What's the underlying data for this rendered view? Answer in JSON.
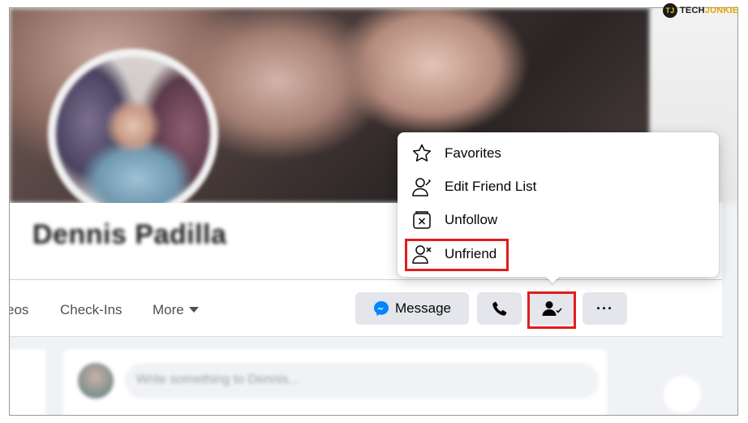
{
  "profile": {
    "name": "Dennis Padilla"
  },
  "nav": {
    "videos_partial": "eos",
    "checkins": "Check-Ins",
    "more": "More"
  },
  "actions": {
    "message_label": "Message",
    "more_label": "···"
  },
  "menu": {
    "items": [
      {
        "label": "Favorites",
        "icon": "star-icon"
      },
      {
        "label": "Edit Friend List",
        "icon": "edit-friend-list-icon"
      },
      {
        "label": "Unfollow",
        "icon": "unfollow-icon"
      },
      {
        "label": "Unfriend",
        "icon": "unfriend-icon"
      }
    ]
  },
  "composer": {
    "placeholder": "Write something to Dennis..."
  },
  "watermark": {
    "badge": "TJ",
    "tech": "TECH",
    "junkie": "JUNKIE"
  },
  "colors": {
    "highlight": "#e01e1e",
    "button_bg": "#e4e6eb",
    "messenger": "#0084ff"
  }
}
